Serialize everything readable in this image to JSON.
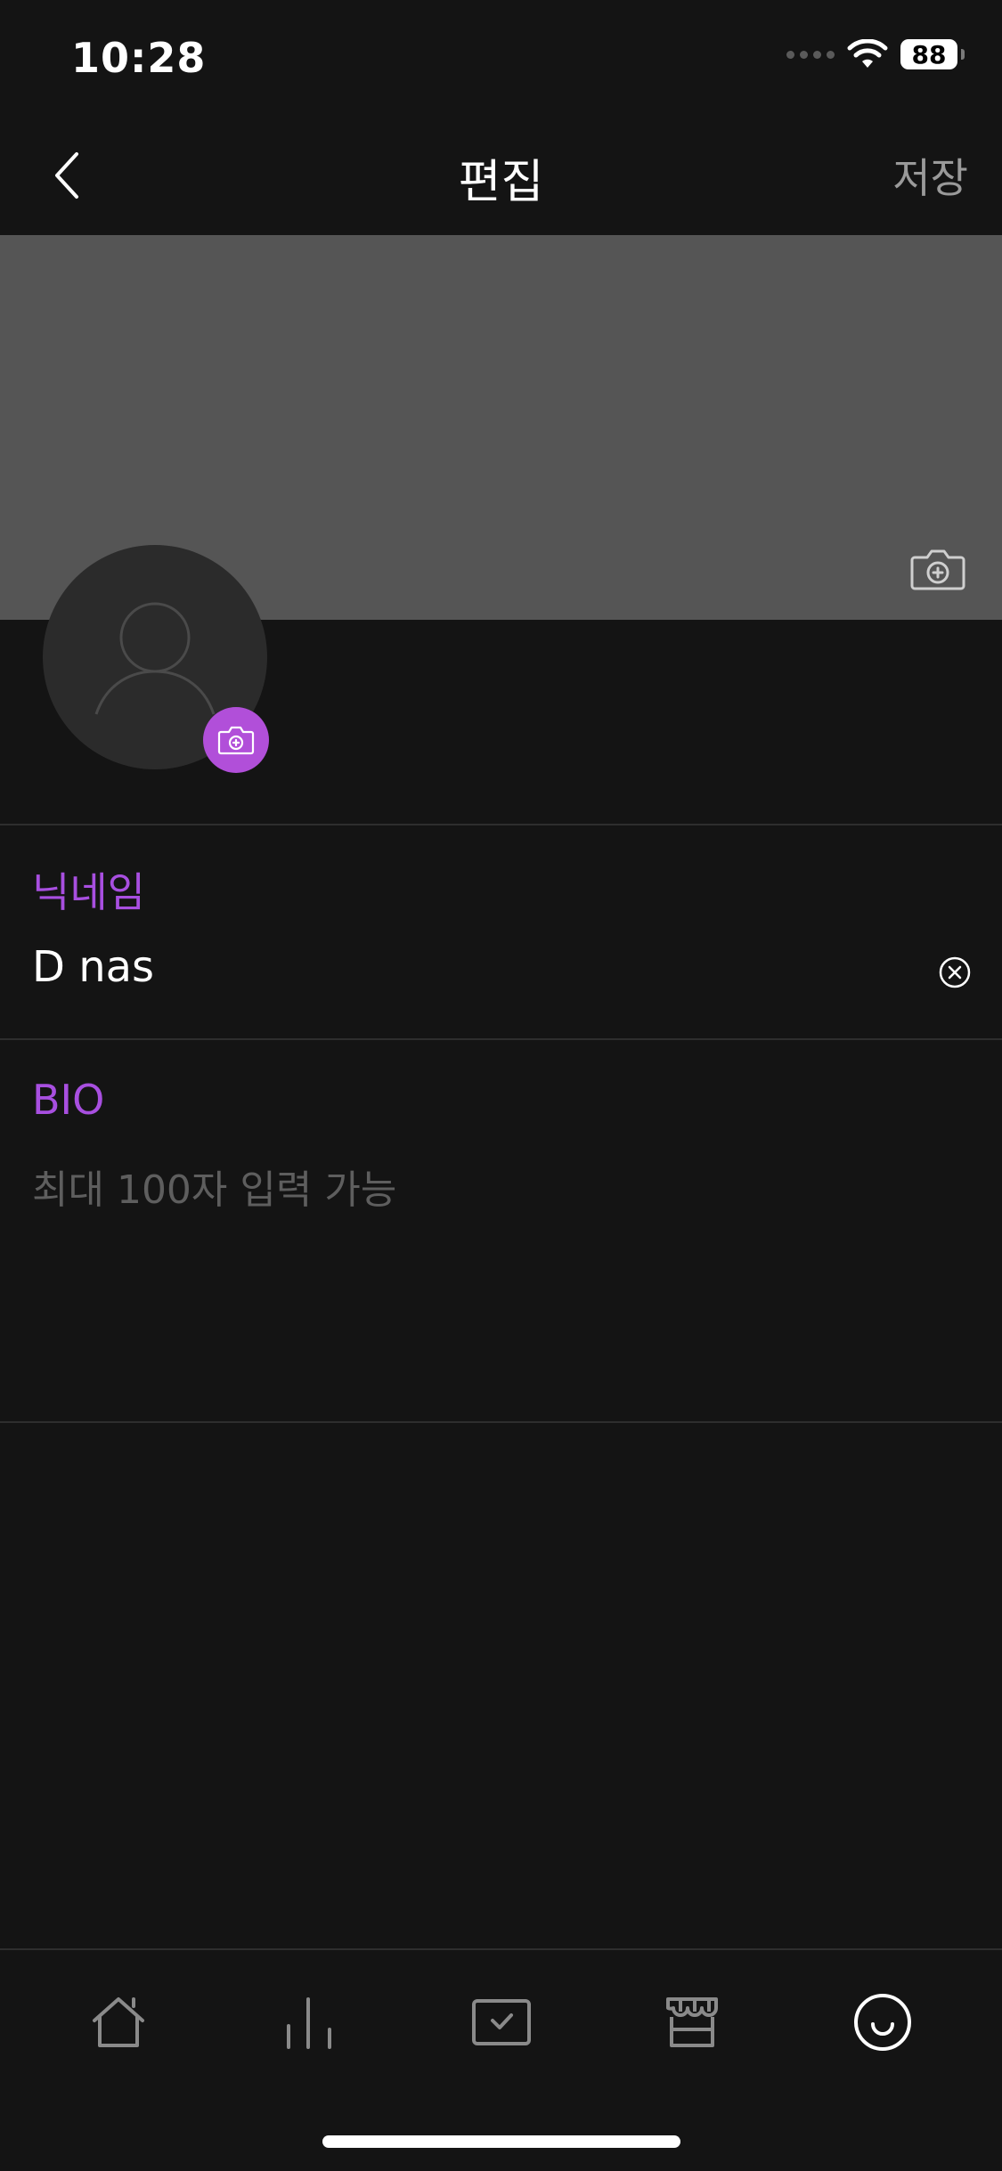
{
  "status_bar": {
    "time": "10:28",
    "battery": "88",
    "icons": [
      "signal-dots-icon",
      "wifi-icon",
      "battery-icon"
    ]
  },
  "header": {
    "title": "편집",
    "save_label": "저장",
    "back_icon": "chevron-left-icon"
  },
  "profile": {
    "cover_camera_icon": "camera-plus-icon",
    "avatar_icon": "person-silhouette-icon",
    "avatar_camera_icon": "camera-plus-icon",
    "accent_color": "#b14fd9"
  },
  "nickname": {
    "label": "닉네임",
    "value": "D nas",
    "clear_icon": "circle-x-icon"
  },
  "bio": {
    "label": "BIO",
    "value": "",
    "placeholder": "최대 100자 입력 가능"
  },
  "tab_bar": {
    "tabs": [
      {
        "icon": "home-icon",
        "active": false
      },
      {
        "icon": "chart-bars-icon",
        "active": false
      },
      {
        "icon": "checkbox-tray-icon",
        "active": false
      },
      {
        "icon": "store-icon",
        "active": false
      },
      {
        "icon": "smile-icon",
        "active": true
      }
    ]
  }
}
